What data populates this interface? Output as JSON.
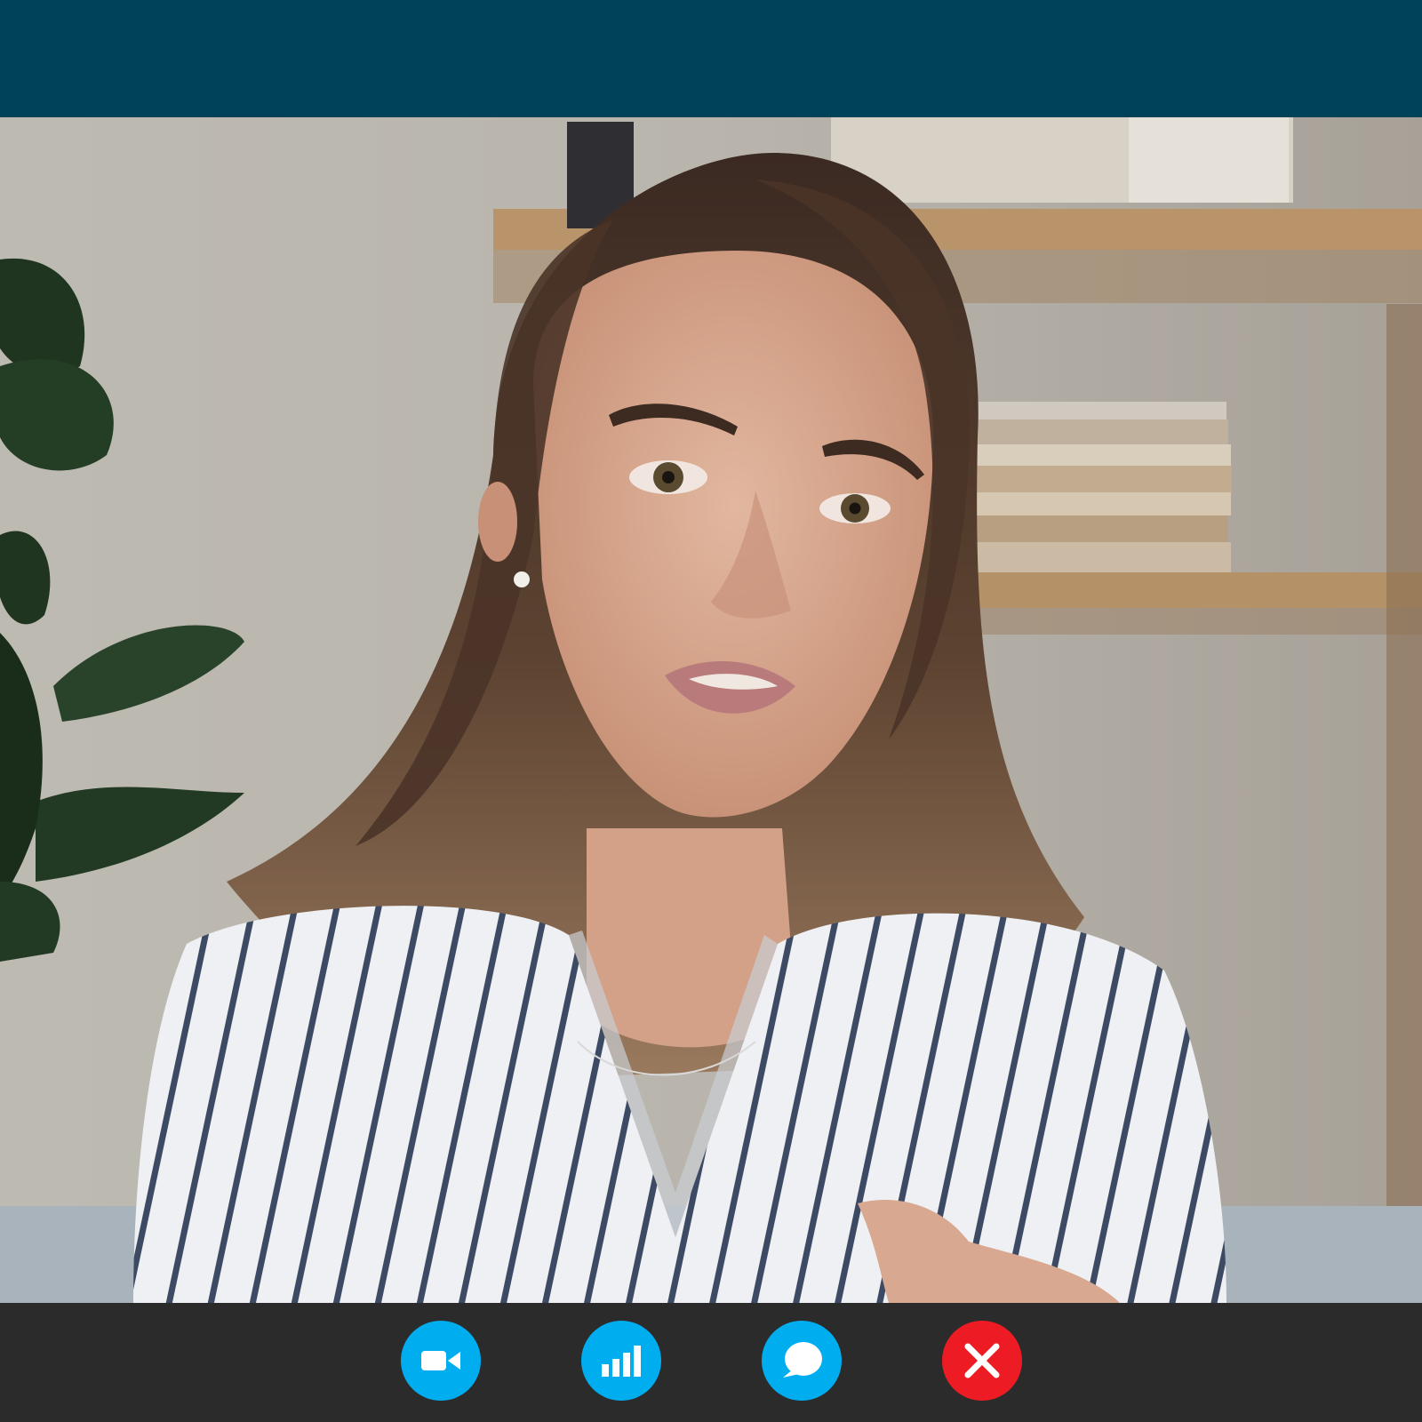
{
  "colors": {
    "top_bar": "#004358",
    "control_bar": "#2b2b2b",
    "control_button": "#00adef",
    "end_call_button": "#ed1c24",
    "icon": "#ffffff"
  },
  "controls": {
    "video": {
      "icon": "video-camera-icon",
      "state": "on"
    },
    "signal": {
      "icon": "signal-bars-icon"
    },
    "chat": {
      "icon": "chat-bubble-icon"
    },
    "end_call": {
      "icon": "close-x-icon"
    }
  }
}
